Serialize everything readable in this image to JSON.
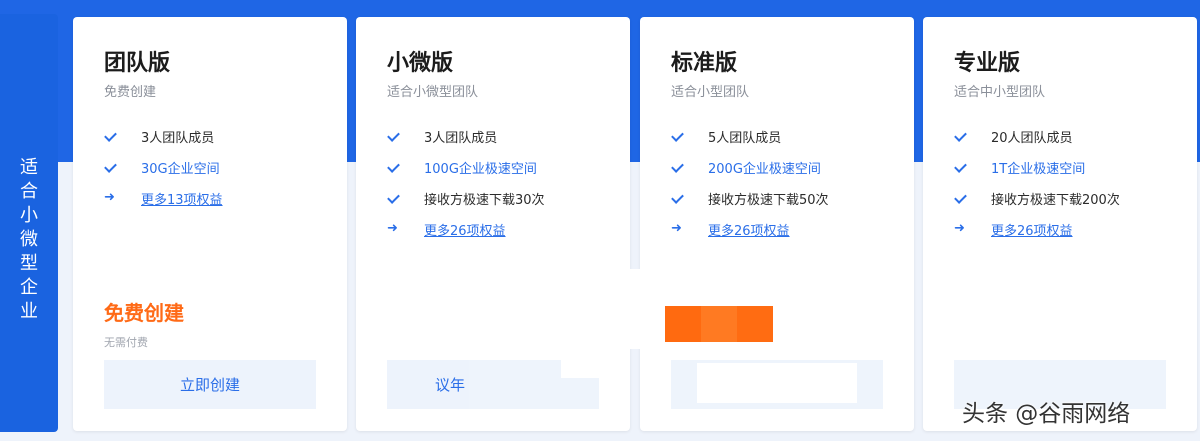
{
  "side_tab": {
    "label": "适合小微型企业"
  },
  "plans": [
    {
      "title": "团队版",
      "subtitle": "免费创建",
      "features": [
        {
          "icon": "check-icon",
          "text": "3人团队成员",
          "style": "normal"
        },
        {
          "icon": "check-icon",
          "text": "30G企业空间",
          "style": "blue"
        },
        {
          "icon": "arrow-icon",
          "text": "更多13项权益",
          "style": "link"
        }
      ],
      "price": "免费创建",
      "price_note": "无需付费",
      "button": "立即创建"
    },
    {
      "title": "小微版",
      "subtitle": "适合小微型团队",
      "features": [
        {
          "icon": "check-icon",
          "text": "3人团队成员",
          "style": "normal"
        },
        {
          "icon": "check-icon",
          "text": "100G企业极速空间",
          "style": "blue"
        },
        {
          "icon": "check-icon",
          "text": "接收方极速下载30次",
          "style": "normal"
        },
        {
          "icon": "arrow-icon",
          "text": "更多26项权益",
          "style": "link"
        }
      ],
      "button_partial": "议年"
    },
    {
      "title": "标准版",
      "subtitle": "适合小型团队",
      "features": [
        {
          "icon": "check-icon",
          "text": "5人团队成员",
          "style": "normal"
        },
        {
          "icon": "check-icon",
          "text": "200G企业极速空间",
          "style": "blue"
        },
        {
          "icon": "check-icon",
          "text": "接收方极速下载50次",
          "style": "normal"
        },
        {
          "icon": "arrow-icon",
          "text": "更多26项权益",
          "style": "link"
        }
      ]
    },
    {
      "title": "专业版",
      "subtitle": "适合中小型团队",
      "features": [
        {
          "icon": "check-icon",
          "text": "20人团队成员",
          "style": "normal"
        },
        {
          "icon": "check-icon",
          "text": "1T企业极速空间",
          "style": "blue"
        },
        {
          "icon": "check-icon",
          "text": "接收方极速下载200次",
          "style": "normal"
        },
        {
          "icon": "arrow-icon",
          "text": "更多26项权益",
          "style": "link"
        }
      ]
    }
  ],
  "watermark": "头条 @谷雨网络",
  "colors": {
    "brand_blue": "#1f66e5",
    "accent_orange": "#ff6a16",
    "link_blue": "#2a6ee8"
  }
}
